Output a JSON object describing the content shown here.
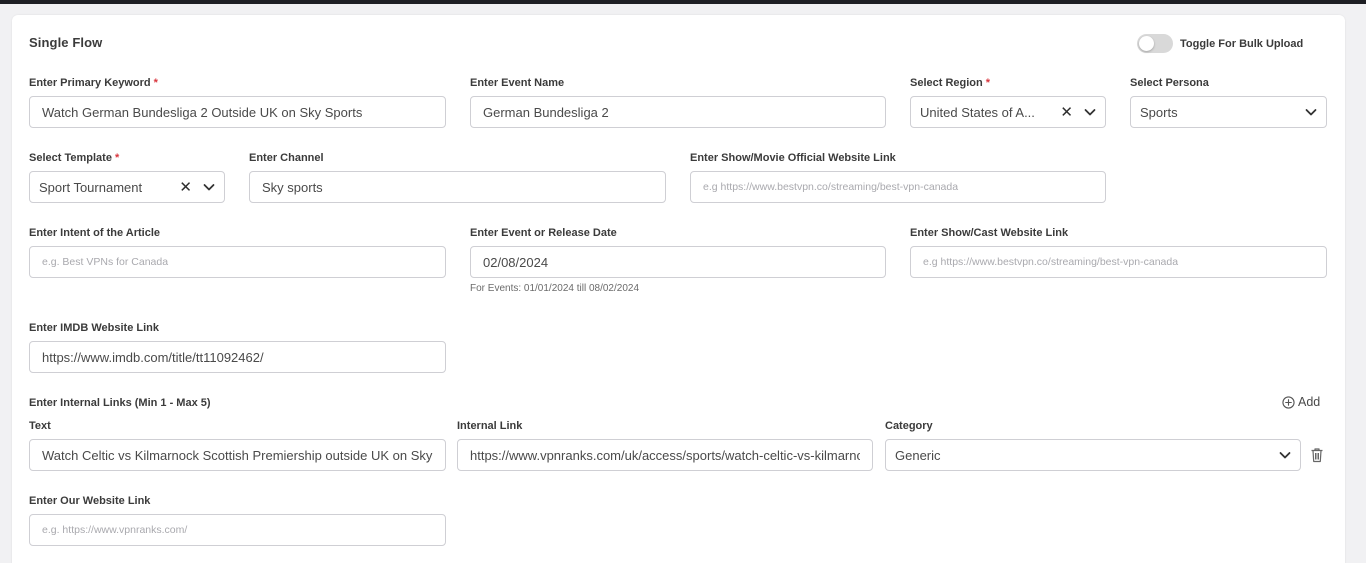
{
  "form": {
    "title": "Single Flow",
    "bulk_toggle": {
      "label": "Toggle For Bulk Upload",
      "on": false
    },
    "primary_keyword": {
      "label": "Enter Primary Keyword",
      "required": "*",
      "value": "Watch German Bundesliga 2 Outside UK on Sky Sports"
    },
    "event_name": {
      "label": "Enter Event Name",
      "value": "German Bundesliga 2"
    },
    "region": {
      "label": "Select Region",
      "required": "*",
      "value": "United States of A..."
    },
    "persona": {
      "label": "Select Persona",
      "value": "Sports"
    },
    "template": {
      "label": "Select Template",
      "required": "*",
      "value": "Sport Tournament"
    },
    "channel": {
      "label": "Enter Channel",
      "value": "Sky sports"
    },
    "official_link": {
      "label": "Enter Show/Movie Official Website Link",
      "placeholder": "e.g https://www.bestvpn.co/streaming/best-vpn-canada"
    },
    "intent": {
      "label": "Enter Intent of the Article",
      "placeholder": "e.g. Best VPNs for Canada"
    },
    "release_date": {
      "label": "Enter Event or Release Date",
      "value": "02/08/2024",
      "hint": "For Events: 01/01/2024 till 08/02/2024"
    },
    "cast_link": {
      "label": "Enter Show/Cast Website Link",
      "placeholder": "e.g https://www.bestvpn.co/streaming/best-vpn-canada"
    },
    "imdb_link": {
      "label": "Enter IMDB Website Link",
      "value": "https://www.imdb.com/title/tt11092462/"
    },
    "internal_links": {
      "label": "Enter Internal Links (Min 1 - Max 5)",
      "add_label": "Add",
      "col_text": "Text",
      "col_link": "Internal Link",
      "col_category": "Category",
      "rows": [
        {
          "text": "Watch Celtic vs Kilmarnock Scottish Premiership outside UK on Sky",
          "link": "https://www.vpnranks.com/uk/access/sports/watch-celtic-vs-kilmarnock",
          "category": "Generic"
        }
      ]
    },
    "our_link": {
      "label": "Enter Our Website Link",
      "placeholder": "e.g. https://www.vpnranks.com/"
    }
  },
  "icons": {
    "clear": "clear-x-icon",
    "dropdown": "chevron-down-icon",
    "add": "plus-circle-icon",
    "delete": "trash-icon"
  }
}
